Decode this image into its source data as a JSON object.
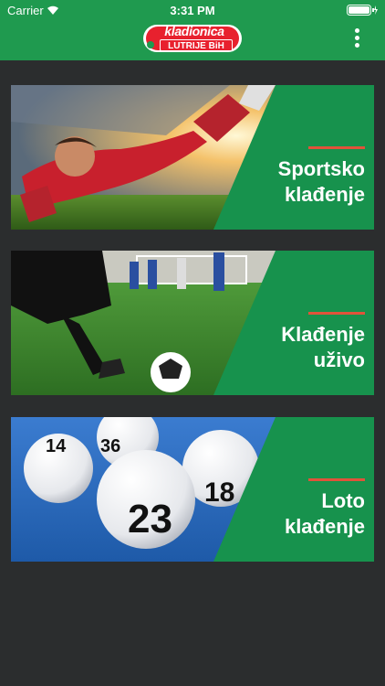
{
  "status_bar": {
    "carrier": "Carrier",
    "time": "3:31 PM"
  },
  "header": {
    "logo_text": "kladionica",
    "logo_subtext": "LUTRIJE BiH",
    "menu_icon": "more-vertical-icon"
  },
  "colors": {
    "header_green": "#1f9a4f",
    "panel_green": "#17924d",
    "background": "#2b2d2e",
    "accent": "#e0533a"
  },
  "cards": [
    {
      "line1": "Sportsko",
      "line2": "klađenje",
      "image": "goalkeeper-diving"
    },
    {
      "line1": "Klađenje",
      "line2": "uživo",
      "image": "football-match"
    },
    {
      "line1": "Loto",
      "line2": "klađenje",
      "image": "lottery-balls"
    }
  ],
  "balls": [
    "14",
    "36",
    "23",
    "18"
  ]
}
